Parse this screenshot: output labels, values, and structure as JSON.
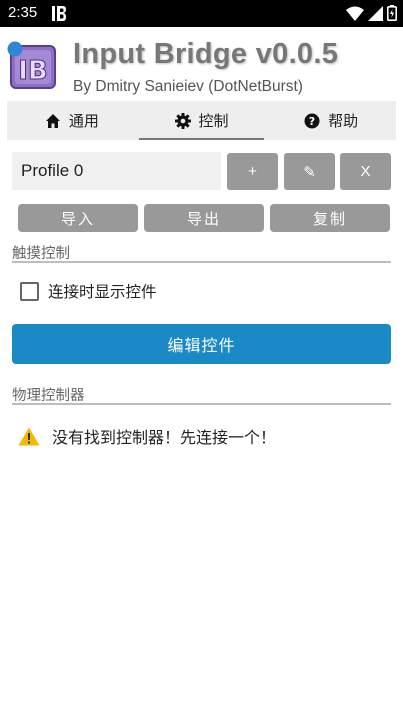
{
  "status_bar": {
    "time": "2:35",
    "app_icon": "IB",
    "icons": [
      "wifi-icon",
      "signal-icon",
      "battery-icon"
    ]
  },
  "header": {
    "title": "Input Bridge v0.0.5",
    "subtitle": "By Dmitry Sanieiev (DotNetBurst)",
    "logo_text": "IB"
  },
  "tabs": [
    {
      "label": "通用",
      "icon": "home-icon",
      "active": false
    },
    {
      "label": "控制",
      "icon": "gear-icon",
      "active": true
    },
    {
      "label": "帮助",
      "icon": "help-icon",
      "active": false
    }
  ],
  "profile": {
    "value": "Profile 0",
    "add_label": "+",
    "edit_label": "✎",
    "delete_label": "X"
  },
  "actions": {
    "import": "导入",
    "export": "导出",
    "copy": "复制"
  },
  "touch_section": {
    "title": "触摸控制",
    "checkbox_label": "连接时显示控件",
    "checked": false,
    "edit_button": "编辑控件"
  },
  "physical_section": {
    "title": "物理控制器",
    "warning": "没有找到控制器！先连接一个！"
  },
  "colors": {
    "primary": "#1a8ac6",
    "button_gray": "#999999",
    "tab_bg": "#eeeeee",
    "warning": "#f5b800"
  }
}
